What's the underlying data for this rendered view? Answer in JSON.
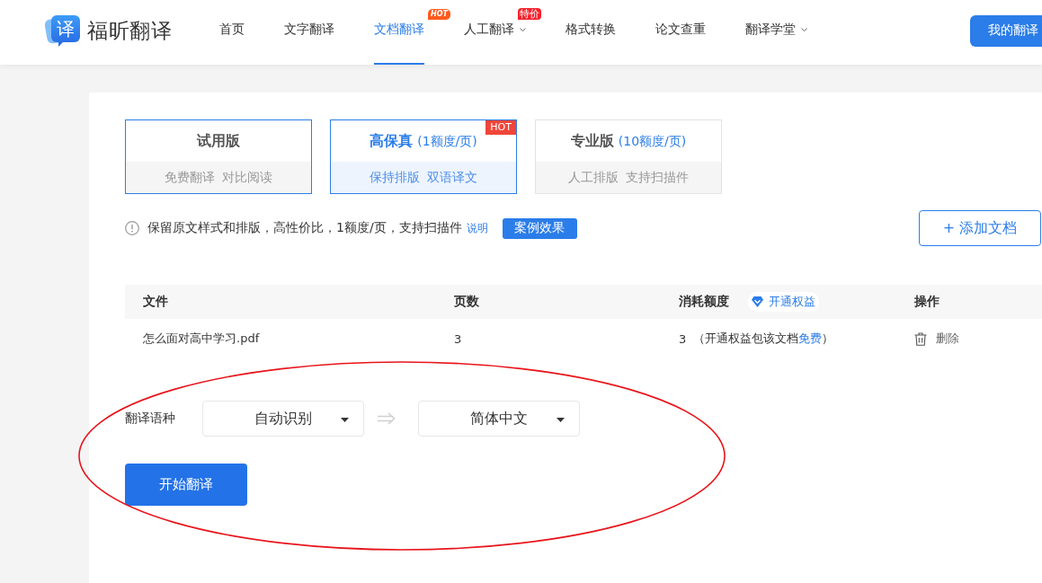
{
  "header": {
    "logo": {
      "mark": "译",
      "name": "福昕翻译"
    },
    "nav": [
      {
        "label": "首页",
        "selected": false,
        "has_menu": false
      },
      {
        "label": "文字翻译",
        "selected": false,
        "has_menu": false
      },
      {
        "label": "文档翻译",
        "selected": true,
        "has_menu": false,
        "badge": {
          "text": "HOT",
          "kind": "hot"
        }
      },
      {
        "label": "人工翻译",
        "selected": false,
        "has_menu": true,
        "badge": {
          "text": "特价",
          "kind": "sale"
        }
      },
      {
        "label": "格式转换",
        "selected": false,
        "has_menu": false
      },
      {
        "label": "论文查重",
        "selected": false,
        "has_menu": false
      },
      {
        "label": "翻译学堂",
        "selected": false,
        "has_menu": true
      }
    ],
    "account_button": "我的翻译"
  },
  "plans": [
    {
      "title": "试用版",
      "features": [
        "免费翻译",
        "对比阅读"
      ],
      "selected": false,
      "highlighted": true
    },
    {
      "title": "高保真",
      "price": "(1额度/页)",
      "features": [
        "保持排版",
        "双语译文"
      ],
      "selected": true,
      "highlighted": false,
      "badge": "HOT"
    },
    {
      "title": "专业版",
      "price": "(10额度/页)",
      "features": [
        "人工排版",
        "支持扫描件"
      ],
      "selected": false,
      "highlighted": false
    }
  ],
  "info": {
    "text": "保留原文样式和排版，高性价比，1额度/页，支持扫描件",
    "link": "说明",
    "button": "案例效果"
  },
  "add_button": "+ 添加文档",
  "table": {
    "columns": [
      {
        "label": "文件"
      },
      {
        "label": "页数"
      },
      {
        "label": "消耗额度",
        "action": "开通权益"
      },
      {
        "label": "操作"
      }
    ],
    "rows": [
      {
        "file": "怎么面对高中学习.pdf",
        "pages": "3",
        "cost": "3",
        "cost_note": "（开通权益包该文档",
        "cost_link": "免费",
        "cost_note_end": "）",
        "action": "删除"
      }
    ]
  },
  "language": {
    "label": "翻译语种",
    "source": "自动识别",
    "target": "简体中文"
  },
  "start_button": "开始翻译",
  "annotations": [
    {
      "kind": "ellipse"
    }
  ]
}
